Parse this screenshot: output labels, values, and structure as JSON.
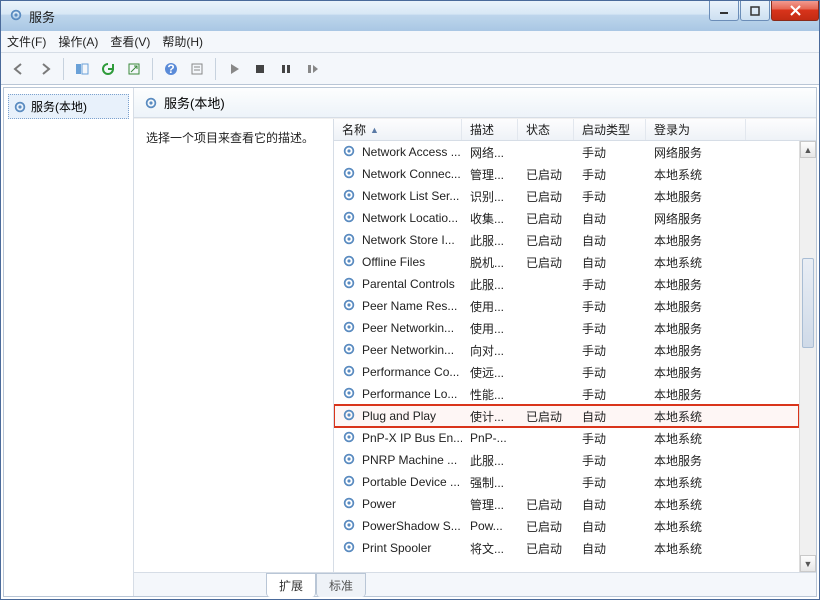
{
  "window": {
    "title": "服务"
  },
  "menu": {
    "file": "文件(F)",
    "action": "操作(A)",
    "view": "查看(V)",
    "help": "帮助(H)"
  },
  "left": {
    "node": "服务(本地)"
  },
  "header": {
    "title": "服务(本地)"
  },
  "desc": {
    "prompt": "选择一个项目来查看它的描述。"
  },
  "columns": {
    "name": "名称",
    "desc": "描述",
    "status": "状态",
    "startup": "启动类型",
    "logon": "登录为"
  },
  "tabs": {
    "extended": "扩展",
    "standard": "标准"
  },
  "highlight_index": 12,
  "services": [
    {
      "name": "Network Access ...",
      "desc": "网络...",
      "status": "",
      "startup": "手动",
      "logon": "网络服务"
    },
    {
      "name": "Network Connec...",
      "desc": "管理...",
      "status": "已启动",
      "startup": "手动",
      "logon": "本地系统"
    },
    {
      "name": "Network List Ser...",
      "desc": "识别...",
      "status": "已启动",
      "startup": "手动",
      "logon": "本地服务"
    },
    {
      "name": "Network Locatio...",
      "desc": "收集...",
      "status": "已启动",
      "startup": "自动",
      "logon": "网络服务"
    },
    {
      "name": "Network Store I...",
      "desc": "此服...",
      "status": "已启动",
      "startup": "自动",
      "logon": "本地服务"
    },
    {
      "name": "Offline Files",
      "desc": "脱机...",
      "status": "已启动",
      "startup": "自动",
      "logon": "本地系统"
    },
    {
      "name": "Parental Controls",
      "desc": "此服...",
      "status": "",
      "startup": "手动",
      "logon": "本地服务"
    },
    {
      "name": "Peer Name Res...",
      "desc": "使用...",
      "status": "",
      "startup": "手动",
      "logon": "本地服务"
    },
    {
      "name": "Peer Networkin...",
      "desc": "使用...",
      "status": "",
      "startup": "手动",
      "logon": "本地服务"
    },
    {
      "name": "Peer Networkin...",
      "desc": "向对...",
      "status": "",
      "startup": "手动",
      "logon": "本地服务"
    },
    {
      "name": "Performance Co...",
      "desc": "使远...",
      "status": "",
      "startup": "手动",
      "logon": "本地服务"
    },
    {
      "name": "Performance Lo...",
      "desc": "性能...",
      "status": "",
      "startup": "手动",
      "logon": "本地服务"
    },
    {
      "name": "Plug and Play",
      "desc": "使计...",
      "status": "已启动",
      "startup": "自动",
      "logon": "本地系统"
    },
    {
      "name": "PnP-X IP Bus En...",
      "desc": "PnP-...",
      "status": "",
      "startup": "手动",
      "logon": "本地系统"
    },
    {
      "name": "PNRP Machine ...",
      "desc": "此服...",
      "status": "",
      "startup": "手动",
      "logon": "本地服务"
    },
    {
      "name": "Portable Device ...",
      "desc": "强制...",
      "status": "",
      "startup": "手动",
      "logon": "本地系统"
    },
    {
      "name": "Power",
      "desc": "管理...",
      "status": "已启动",
      "startup": "自动",
      "logon": "本地系统"
    },
    {
      "name": "PowerShadow S...",
      "desc": "Pow...",
      "status": "已启动",
      "startup": "自动",
      "logon": "本地系统"
    },
    {
      "name": "Print Spooler",
      "desc": "将文...",
      "status": "已启动",
      "startup": "自动",
      "logon": "本地系统"
    }
  ]
}
